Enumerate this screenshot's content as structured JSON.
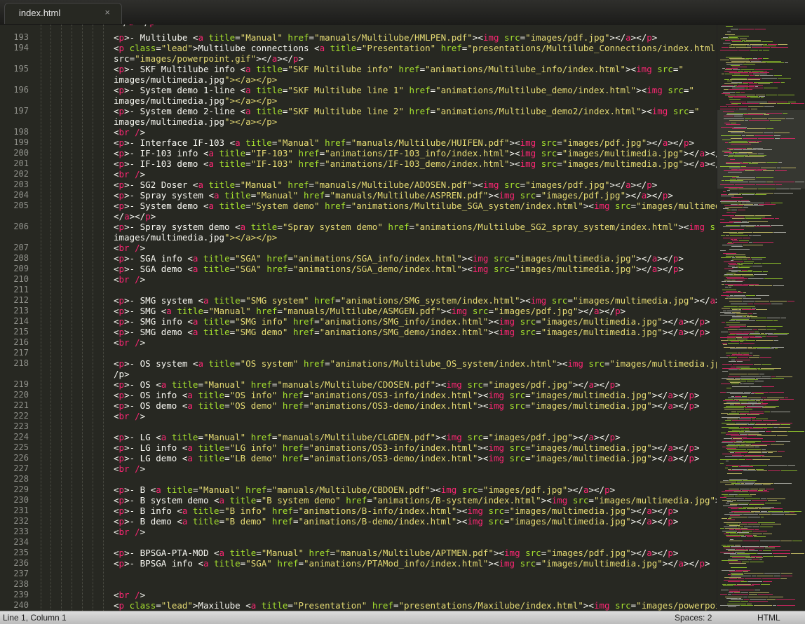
{
  "tab": {
    "filename": "index.html",
    "close_glyph": "×"
  },
  "status": {
    "position": "Line 1, Column 1",
    "indentation": "Spaces: 2",
    "syntax": "HTML"
  },
  "colors": {
    "background": "#272822",
    "tag": "#f92672",
    "attribute": "#a6e22e",
    "string": "#e6db74",
    "text": "#f8f8f2",
    "line_number": "#8f908a"
  },
  "gutter": [
    "193",
    "194",
    "",
    "195",
    "",
    "196",
    "",
    "197",
    "",
    "198",
    "199",
    "200",
    "201",
    "202",
    "203",
    "204",
    "205",
    "",
    "206",
    "",
    "207",
    "208",
    "209",
    "210",
    "211",
    "212",
    "213",
    "214",
    "215",
    "216",
    "217",
    "218",
    "",
    "219",
    "220",
    "221",
    "222",
    "223",
    "224",
    "225",
    "226",
    "227",
    "228",
    "229",
    "230",
    "231",
    "232",
    "233",
    "234",
    "235",
    "236",
    "237",
    "238",
    "239",
    "240"
  ],
  "top_partial_line": "</a></p>",
  "code_lines": [
    "<p>- Multilube <a title=\"Manual\" href=\"manuals/Multilube/HMLPEN.pdf\"><img src=\"images/pdf.jpg\"></a></p>",
    "<p class=\"lead\">Multilube connections <a title=\"Presentation\" href=\"presentations/Multilube_Connections/index.html\"><img",
    "src=\"images/powerpoint.gif\"></a></p>",
    "<p>- SKF Multilube info <a title=\"SKF Multilube info\" href=\"animations/Multilube_info/index.html\"><img src=\"",
    "images/multimedia.jpg\"></a></p>",
    "<p>- System demo 1-line <a title=\"SKF Multilube line 1\" href=\"animations/Multilube_demo/index.html\"><img src=\"",
    "images/multimedia.jpg\"></a></p>",
    "<p>- System demo 2-line <a title=\"SKF Multilube line 2\" href=\"animations/Multilube_demo2/index.html\"><img src=\"",
    "images/multimedia.jpg\"></a></p>",
    "<br />",
    "<p>- Interface IF-103 <a title=\"Manual\" href=\"manuals/Multilube/HUIFEN.pdf\"><img src=\"images/pdf.jpg\"></a></p>",
    "<p>- IF-103 info <a title=\"IF-103\" href=\"animations/IF-103_info/index.html\"><img src=\"images/multimedia.jpg\"></a></p>",
    "<p>- IF-103 demo <a title=\"IF-103\" href=\"animations/IF-103_demo/index.html\"><img src=\"images/multimedia.jpg\"></a></p>",
    "<br />",
    "<p>- SG2 Doser <a title=\"Manual\" href=\"manuals/Multilube/ADOSEN.pdf\"><img src=\"images/pdf.jpg\"></a></p>",
    "<p>- Spray system <a title=\"Manual\" href=\"manuals/Multilube/ASPREN.pdf\"><img src=\"images/pdf.jpg\"></a></p>",
    "<p>- System demo <a title=\"System demo\" href=\"animations/Multilube_SGA_system/index.html\"><img src=\"images/multimedia.jpg\">",
    "</a></p>",
    "<p>- Spray system demo <a title=\"Spray system demo\" href=\"animations/Multilube_SG2_spray_system/index.html\"><img src=\"",
    "images/multimedia.jpg\"></a></p>",
    "<br />",
    "<p>- SGA info <a title=\"SGA\" href=\"animations/SGA_info/index.html\"><img src=\"images/multimedia.jpg\"></a></p>",
    "<p>- SGA demo <a title=\"SGA\" href=\"animations/SGA_demo/index.html\"><img src=\"images/multimedia.jpg\"></a></p>",
    "<br />",
    "",
    "<p>- SMG system <a title=\"SMG system\" href=\"animations/SMG_system/index.html\"><img src=\"images/multimedia.jpg\"></a></p>",
    "<p>- SMG <a title=\"Manual\" href=\"manuals/Multilube/ASMGEN.pdf\"><img src=\"images/pdf.jpg\"></a></p>",
    "<p>- SMG info <a title=\"SMG info\" href=\"animations/SMG_info/index.html\"><img src=\"images/multimedia.jpg\"></a></p>",
    "<p>- SMG demo <a title=\"SMG demo\" href=\"animations/SMG_demo/index.html\"><img src=\"images/multimedia.jpg\"></a></p>",
    "<br />",
    "",
    "<p>- OS system <a title=\"OS system\" href=\"animations/Multilube_OS_system/index.html\"><img src=\"images/multimedia.jpg\"></a><",
    "/p>",
    "<p>- OS <a title=\"Manual\" href=\"manuals/Multilube/CDOSEN.pdf\"><img src=\"images/pdf.jpg\"></a></p>",
    "<p>- OS info <a title=\"OS info\" href=\"animations/OS3-info/index.html\"><img src=\"images/multimedia.jpg\"></a></p>",
    "<p>- OS demo <a title=\"OS demo\" href=\"animations/OS3-demo/index.html\"><img src=\"images/multimedia.jpg\"></a></p>",
    "<br />",
    "",
    "<p>- LG <a title=\"Manual\" href=\"manuals/Multilube/CLGDEN.pdf\"><img src=\"images/pdf.jpg\"></a></p>",
    "<p>- LG info <a title=\"LG info\" href=\"animations/OS3-info/index.html\"><img src=\"images/multimedia.jpg\"></a></p>",
    "<p>- LG demo <a title=\"LB demo\" href=\"animations/OS3-demo/index.html\"><img src=\"images/multimedia.jpg\"></a></p>",
    "<br />",
    "",
    "<p>- B <a title=\"Manual\" href=\"manuals/Multilube/CBDOEN.pdf\"><img src=\"images/pdf.jpg\"></a></p>",
    "<p>- B system demo <a title=\"B system demo\" href=\"animations/B-system/index.html\"><img src=\"images/multimedia.jpg\"></a></p>",
    "<p>- B info <a title=\"B info\" href=\"animations/B-info/index.html\"><img src=\"images/multimedia.jpg\"></a></p>",
    "<p>- B demo <a title=\"B demo\" href=\"animations/B-demo/index.html\"><img src=\"images/multimedia.jpg\"></a></p>",
    "<br />",
    "",
    "<p>- BPSGA-PTA-MOD <a title=\"Manual\" href=\"manuals/Multilube/APTMEN.pdf\"><img src=\"images/pdf.jpg\"></a></p>",
    "<p>- BPSGA info <a title=\"SGA\" href=\"animations/PTAMod_info/index.html\"><img src=\"images/multimedia.jpg\"></a></p>",
    "",
    "",
    "<br />",
    "<p class=\"lead\">Maxilube <a title=\"Presentation\" href=\"presentations/Maxilube/index.html\"><img src=\"images/powerpoint.gif\">"
  ]
}
